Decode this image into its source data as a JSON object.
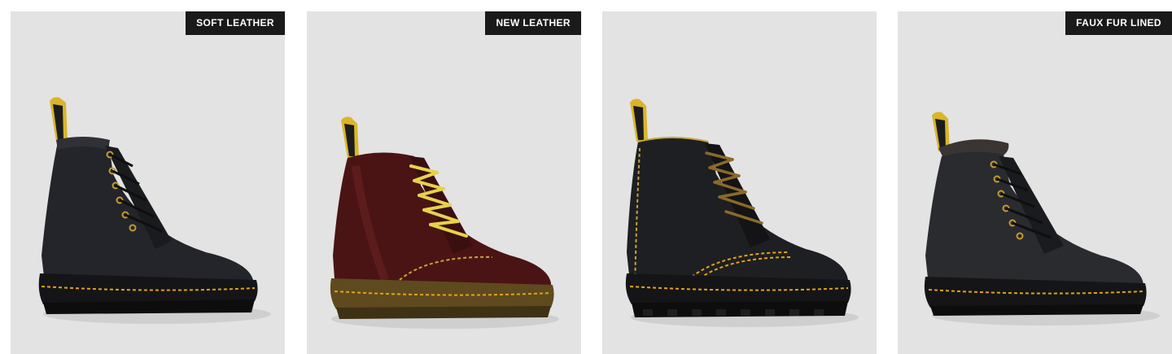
{
  "products": [
    {
      "badge": "SOFT LEATHER",
      "image_alt": "Black soft leather 8-eye lace up boot",
      "icon": "boot-image"
    },
    {
      "badge": "NEW LEATHER",
      "image_alt": "Oxblood leather 8-eye boot with yellow laces",
      "icon": "boot-image"
    },
    {
      "badge": "",
      "image_alt": "Black leather boot with yellow double stitching",
      "icon": "boot-image"
    },
    {
      "badge": "FAUX FUR LINED",
      "image_alt": "Black faux fur lined 8-eye boot",
      "icon": "boot-image"
    }
  ],
  "colors": {
    "card_bg": "#e3e3e3",
    "badge_bg": "#1a1a1a",
    "badge_text": "#ffffff",
    "welt_stitch": "#e3a21a",
    "pull_tab": "#e8c21c"
  }
}
